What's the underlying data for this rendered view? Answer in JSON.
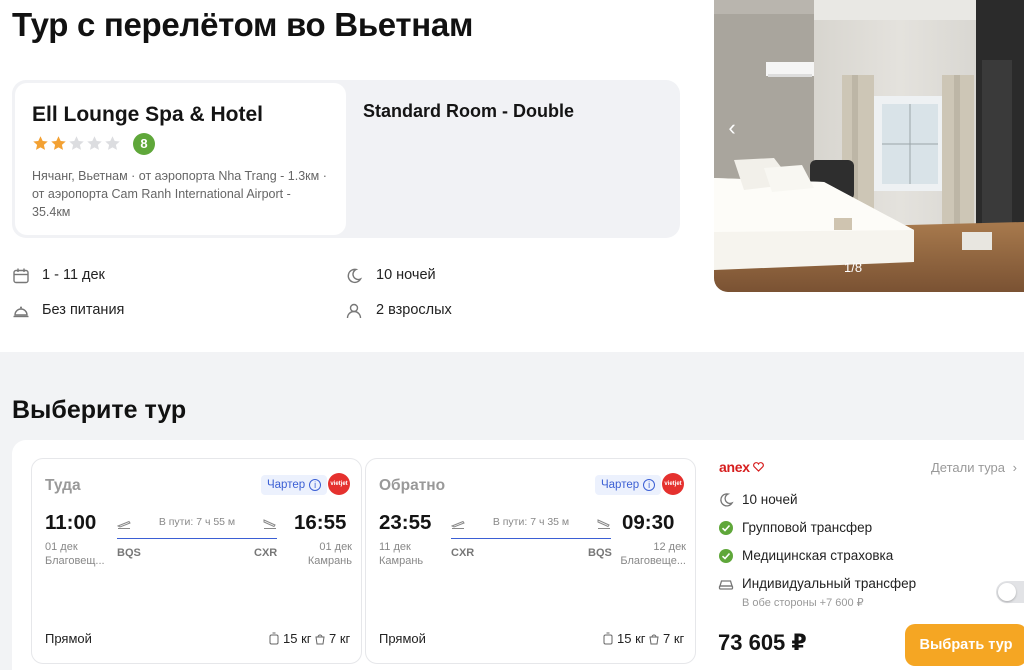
{
  "page_title": "Тур с перелётом во Вьетнам",
  "hotel": {
    "name": "Ell Lounge Spa & Hotel",
    "stars": 2,
    "max_stars": 5,
    "rating": "8",
    "location": "Нячанг, Вьетнам · от аэропорта Nha Trang - 1.3км · от аэропорта Cam Ranh International Airport - 35.4км",
    "room": "Standard Room - Double"
  },
  "gallery": {
    "counter": "1/8",
    "prev_icon": "chevron-left-icon"
  },
  "trip_info": {
    "dates": "1 - 11 дек",
    "nights": "10 ночей",
    "meal": "Без питания",
    "guests": "2 взрослых"
  },
  "section_title": "Выберите тур",
  "flights": [
    {
      "title": "Туда",
      "badge": "Чартер",
      "dep_time": "11:00",
      "dep_date": "01 дек",
      "dep_city": "Благовещ...",
      "dep_code": "BQS",
      "duration": "В пути: 7 ч 55 м",
      "arr_time": "16:55",
      "arr_date": "01 дек",
      "arr_city": "Камрань",
      "arr_code": "CXR",
      "type": "Прямой",
      "baggage": "15 кг",
      "hand": "7 кг"
    },
    {
      "title": "Обратно",
      "badge": "Чартер",
      "dep_time": "23:55",
      "dep_date": "11 дек",
      "dep_city": "Камрань",
      "dep_code": "CXR",
      "duration": "В пути: 7 ч 35 м",
      "arr_time": "09:30",
      "arr_date": "12 дек",
      "arr_city": "Благовеще...",
      "arr_code": "BQS",
      "type": "Прямой",
      "baggage": "15 кг",
      "hand": "7 кг"
    }
  ],
  "tour": {
    "operator": "anex",
    "details": "Детали тура",
    "features": {
      "nights": "10 ночей",
      "transfer": "Групповой трансфер",
      "insurance": "Медицинская страховка",
      "individual": "Индивидуальный трансфер",
      "individual_sub": "В обе стороны +7 600 ₽"
    },
    "price": "73 605 ₽",
    "select_button": "Выбрать тур"
  },
  "colors": {
    "accent": "#f5a623",
    "rating": "#5fa73a",
    "star": "#f3a133",
    "check": "#5fa73a",
    "charter": "#3b5fd4"
  }
}
